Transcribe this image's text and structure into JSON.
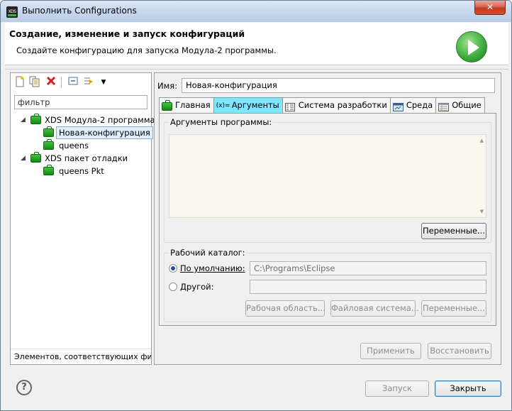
{
  "window": {
    "title": "Выполнить Configurations",
    "close_label": "✕",
    "app_icon_text": "XDS"
  },
  "banner": {
    "title": "Создание, изменение и запуск конфигураций",
    "description": "Создайте конфигурацию для запуска Модула-2 программы."
  },
  "left": {
    "toolbar": [
      "new-config-icon",
      "duplicate-icon",
      "delete-icon",
      "collapse-all-icon",
      "filter-icon",
      "dropdown-arrow-icon"
    ],
    "filter_value": "фильтр",
    "tree": [
      {
        "label": "XDS Модула-2 программа",
        "children": [
          "Новая-конфигурация",
          "queens"
        ]
      },
      {
        "label": "XDS пакет отладки",
        "children": [
          "queens Pkt"
        ]
      }
    ],
    "status": "Элементов, соответствующих филь"
  },
  "right": {
    "name_label": "Имя:",
    "name_value": "Новая-конфигурация",
    "tabs": [
      {
        "label": "Главная",
        "icon": "case-icon"
      },
      {
        "label": "Аргументы",
        "icon": "variables-icon"
      },
      {
        "label": "Система разработки",
        "icon": "env-icon"
      },
      {
        "label": "Среда",
        "icon": "environment-icon"
      },
      {
        "label": "Общие",
        "icon": "common-icon"
      }
    ],
    "active_tab": "Аргументы",
    "program_args": {
      "title": "Аргументы программы:",
      "value": "",
      "variables_button": "Переменные..."
    },
    "workdir": {
      "title": "Рабочий каталог:",
      "default_label": "По умолчанию:",
      "default_value": "C:\\Programs\\Eclipse",
      "other_label": "Другой:",
      "other_value": "",
      "workspace_button": "Рабочая область...",
      "filesystem_button": "Файловая система...",
      "variables_button": "Переменные..."
    },
    "apply_button": "Применить",
    "revert_button": "Восстановить"
  },
  "footer": {
    "run_button": "Запуск",
    "close_button": "Закрыть",
    "help_label": "?"
  }
}
